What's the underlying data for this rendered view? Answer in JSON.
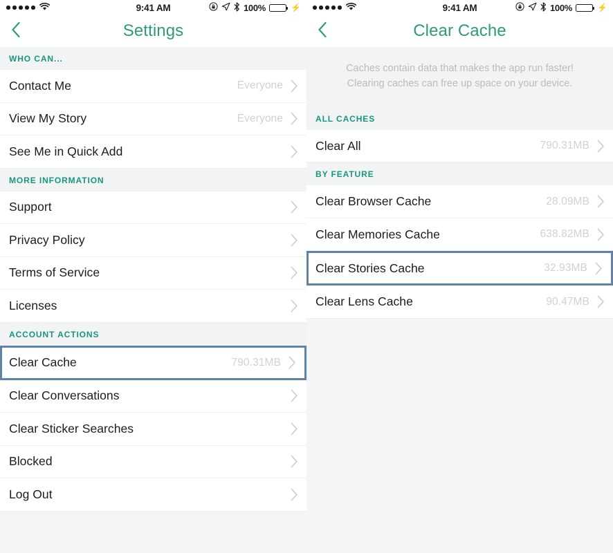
{
  "status_bar": {
    "signal_dots": 5,
    "wifi_icon": "wifi-icon",
    "time": "9:41 AM",
    "rotation_lock_icon": "rotation-lock-icon",
    "location_icon": "location-arrow-icon",
    "bluetooth_icon": "bluetooth-icon",
    "battery_percent": "100%",
    "battery_icon": "battery-full-icon",
    "charging_icon": "lightning-bolt-icon"
  },
  "colors": {
    "accent_title": "#2e9b7c",
    "section_header": "#17967e",
    "highlight_border": "#5f82a6",
    "value_text": "#cfd1d3",
    "row_background": "#ffffff",
    "page_background": "#f4f5f6",
    "section_background": "#f2f3f4",
    "battery_fill": "#3ece5a"
  },
  "left_screen": {
    "nav": {
      "back_icon": "chevron-left-icon",
      "title": "Settings"
    },
    "sections": [
      {
        "header": "WHO CAN...",
        "rows": [
          {
            "label": "Contact Me",
            "value": "Everyone",
            "chevron": "chevron-right-icon",
            "highlighted": false
          },
          {
            "label": "View My Story",
            "value": "Everyone",
            "chevron": "chevron-right-icon",
            "highlighted": false
          },
          {
            "label": "See Me in Quick Add",
            "value": "",
            "chevron": "chevron-right-icon",
            "highlighted": false
          }
        ]
      },
      {
        "header": "MORE INFORMATION",
        "rows": [
          {
            "label": "Support",
            "value": "",
            "chevron": "chevron-right-icon",
            "highlighted": false
          },
          {
            "label": "Privacy Policy",
            "value": "",
            "chevron": "chevron-right-icon",
            "highlighted": false
          },
          {
            "label": "Terms of Service",
            "value": "",
            "chevron": "chevron-right-icon",
            "highlighted": false
          },
          {
            "label": "Licenses",
            "value": "",
            "chevron": "chevron-right-icon",
            "highlighted": false
          }
        ]
      },
      {
        "header": "ACCOUNT ACTIONS",
        "rows": [
          {
            "label": "Clear Cache",
            "value": "790.31MB",
            "chevron": "chevron-right-icon",
            "highlighted": true
          },
          {
            "label": "Clear Conversations",
            "value": "",
            "chevron": "chevron-right-icon",
            "highlighted": false
          },
          {
            "label": "Clear Sticker Searches",
            "value": "",
            "chevron": "chevron-right-icon",
            "highlighted": false
          },
          {
            "label": "Blocked",
            "value": "",
            "chevron": "chevron-right-icon",
            "highlighted": false
          },
          {
            "label": "Log Out",
            "value": "",
            "chevron": "chevron-right-icon",
            "highlighted": false
          }
        ]
      }
    ]
  },
  "right_screen": {
    "nav": {
      "back_icon": "chevron-left-icon",
      "title": "Clear Cache"
    },
    "description": "Caches contain data that makes the app run faster! Clearing caches can free up space on your device.",
    "sections": [
      {
        "header": "ALL CACHES",
        "rows": [
          {
            "label": "Clear All",
            "value": "790.31MB",
            "chevron": "chevron-right-icon",
            "highlighted": false
          }
        ]
      },
      {
        "header": "BY FEATURE",
        "rows": [
          {
            "label": "Clear Browser Cache",
            "value": "28.09MB",
            "chevron": "chevron-right-icon",
            "highlighted": false
          },
          {
            "label": "Clear Memories Cache",
            "value": "638.82MB",
            "chevron": "chevron-right-icon",
            "highlighted": false
          },
          {
            "label": "Clear Stories Cache",
            "value": "32.93MB",
            "chevron": "chevron-right-icon",
            "highlighted": true
          },
          {
            "label": "Clear Lens Cache",
            "value": "90.47MB",
            "chevron": "chevron-right-icon",
            "highlighted": false
          }
        ]
      }
    ]
  }
}
